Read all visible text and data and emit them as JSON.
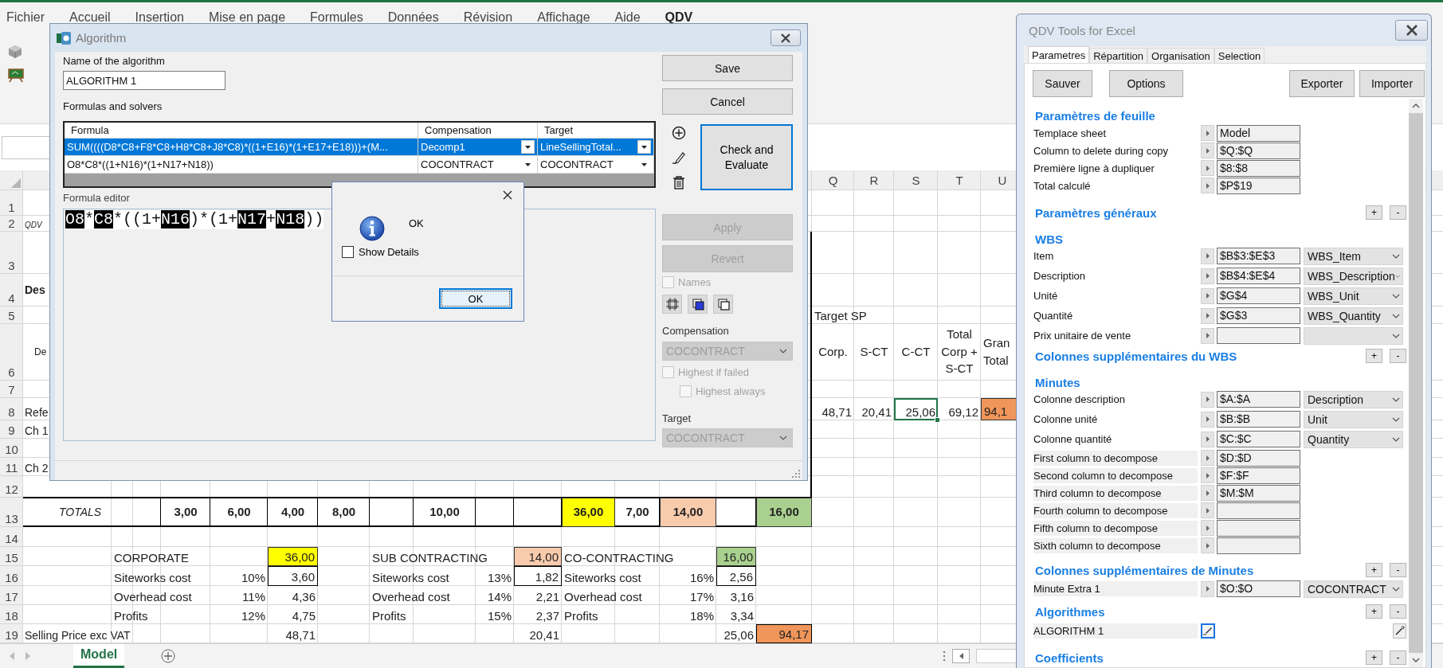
{
  "ribbon": {
    "tabs": [
      {
        "label": "Fichier",
        "selected": false
      },
      {
        "label": "Accueil",
        "selected": false
      },
      {
        "label": "Insertion",
        "selected": false
      },
      {
        "label": "Mise en page",
        "selected": false
      },
      {
        "label": "Formules",
        "selected": false
      },
      {
        "label": "Données",
        "selected": false
      },
      {
        "label": "Révision",
        "selected": false
      },
      {
        "label": "Affichage",
        "selected": false
      },
      {
        "label": "Aide",
        "selected": false
      },
      {
        "label": "QDV",
        "selected": true
      }
    ]
  },
  "sheet": {
    "columns": [
      {
        "label": "Q"
      },
      {
        "label": "R"
      },
      {
        "label": "S"
      },
      {
        "label": "T"
      },
      {
        "label": "U"
      }
    ],
    "rows": [
      {
        "number": "1"
      },
      {
        "number": "2",
        "cells": [
          {
            "text": "QDV",
            "kind": "note",
            "selected": false
          }
        ]
      },
      {
        "number": "3"
      },
      {
        "number": "4",
        "cells": [
          {
            "text": "Des",
            "kind": "bold",
            "selected": false
          }
        ]
      },
      {
        "number": "5",
        "cells": [
          null,
          null,
          null,
          null,
          null,
          null,
          null,
          null,
          null,
          null,
          null,
          null,
          null,
          null,
          null,
          null,
          {
            "text": "Target SP",
            "kind": "text",
            "selected": false
          }
        ]
      },
      {
        "number": "6",
        "cells": [
          {
            "text": "De",
            "kind": "small",
            "selected": false
          },
          null,
          null,
          null,
          null,
          null,
          null,
          null,
          null,
          null,
          null,
          null,
          null,
          null,
          null,
          null,
          {
            "text": "Corp.",
            "kind": "heading",
            "selected": false
          },
          {
            "text": "S-CT",
            "kind": "heading",
            "selected": false
          },
          {
            "text": "C-CT",
            "kind": "heading",
            "selected": false
          },
          {
            "text": "Total Corp + S-CT",
            "kind": "heading",
            "selected": false
          },
          {
            "text": "Gran Total",
            "kind": "heading_left",
            "selected": false
          }
        ]
      },
      {
        "number": "7"
      },
      {
        "number": "8",
        "cells": [
          {
            "text": "Refe",
            "kind": "text",
            "selected": false
          },
          null,
          null,
          null,
          null,
          null,
          null,
          null,
          null,
          null,
          null,
          null,
          null,
          null,
          null,
          null,
          {
            "text": "48,71",
            "kind": "number",
            "selected": false
          },
          {
            "text": "20,41",
            "kind": "number",
            "selected": false
          },
          {
            "text": "25,06",
            "kind": "number",
            "selected": true
          },
          {
            "text": "69,12",
            "kind": "number",
            "selected": false
          },
          {
            "text": "94,1",
            "kind": "text",
            "color": "#f0965a",
            "selected": false
          }
        ]
      },
      {
        "number": "9",
        "cells": [
          {
            "text": "Ch 1",
            "kind": "text",
            "selected": false
          }
        ]
      },
      {
        "number": "10"
      },
      {
        "number": "11",
        "cells": [
          {
            "text": "Ch 2",
            "kind": "text",
            "selected": false
          }
        ]
      },
      {
        "number": "12"
      },
      {
        "number": "13",
        "kind": "totals",
        "cells": [
          {
            "text": "TOTALS",
            "kind": "total_label",
            "selected": false
          },
          null,
          null,
          {
            "text": "3,00",
            "kind": "number",
            "selected": false
          },
          {
            "text": "6,00",
            "kind": "number",
            "selected": false
          },
          {
            "text": "4,00",
            "kind": "number",
            "selected": false
          },
          {
            "text": "8,00",
            "kind": "number",
            "selected": false
          },
          null,
          {
            "text": "10,00",
            "kind": "number",
            "selected": false
          },
          null,
          null,
          {
            "text": "36,00",
            "kind": "number",
            "color": "#ffff00",
            "selected": false
          },
          {
            "text": "7,00",
            "kind": "number",
            "selected": false
          },
          {
            "text": "14,00",
            "kind": "number",
            "color": "#f8cbad",
            "selected": false
          },
          null,
          {
            "text": "16,00",
            "kind": "number",
            "color": "#a9d08e",
            "selected": false
          }
        ]
      },
      {
        "number": "14"
      },
      {
        "number": "15",
        "cells": [
          null,
          {
            "text": "CORPORATE",
            "kind": "text",
            "selected": false
          },
          null,
          null,
          null,
          {
            "text": "36,00",
            "kind": "number",
            "color": "#ffff00",
            "selected": false
          },
          null,
          {
            "text": "SUB CONTRACTING",
            "kind": "text",
            "selected": false
          },
          null,
          null,
          {
            "text": "14,00",
            "kind": "number",
            "color": "#f8cbad",
            "selected": false
          },
          {
            "text": "CO-CONTRACTING",
            "kind": "text",
            "selected": false
          },
          null,
          null,
          {
            "text": "16,00",
            "kind": "number",
            "color": "#a9d08e",
            "selected": false
          }
        ]
      },
      {
        "number": "16",
        "cells": [
          null,
          {
            "text": "Siteworks cost",
            "kind": "text",
            "selected": false
          },
          null,
          null,
          {
            "text": "10%",
            "kind": "number",
            "selected": false
          },
          {
            "text": "3,60",
            "kind": "number",
            "boxed": true,
            "selected": false
          },
          null,
          {
            "text": "Siteworks cost",
            "kind": "text",
            "selected": false
          },
          null,
          {
            "text": "13%",
            "kind": "number",
            "selected": false
          },
          {
            "text": "1,82",
            "kind": "number",
            "boxed": true,
            "selected": false
          },
          {
            "text": "Siteworks cost",
            "kind": "text",
            "selected": false
          },
          null,
          {
            "text": "16%",
            "kind": "number",
            "selected": false
          },
          {
            "text": "2,56",
            "kind": "number",
            "boxed": true,
            "selected": false
          }
        ]
      },
      {
        "number": "17",
        "cells": [
          null,
          {
            "text": "Overhead cost",
            "kind": "text",
            "selected": false
          },
          null,
          null,
          {
            "text": "11%",
            "kind": "number",
            "selected": false
          },
          {
            "text": "4,36",
            "kind": "number",
            "selected": false
          },
          null,
          {
            "text": "Overhead cost",
            "kind": "text",
            "selected": false
          },
          null,
          {
            "text": "14%",
            "kind": "number",
            "selected": false
          },
          {
            "text": "2,21",
            "kind": "number",
            "selected": false
          },
          {
            "text": "Overhead cost",
            "kind": "text",
            "selected": false
          },
          null,
          {
            "text": "17%",
            "kind": "number",
            "selected": false
          },
          {
            "text": "3,16",
            "kind": "number",
            "selected": false
          }
        ]
      },
      {
        "number": "18",
        "cells": [
          null,
          {
            "text": "Profits",
            "kind": "text",
            "selected": false
          },
          null,
          null,
          {
            "text": "12%",
            "kind": "number",
            "selected": false
          },
          {
            "text": "4,75",
            "kind": "number",
            "selected": false
          },
          null,
          {
            "text": "Profits",
            "kind": "text",
            "selected": false
          },
          null,
          {
            "text": "15%",
            "kind": "number",
            "selected": false
          },
          {
            "text": "2,37",
            "kind": "number",
            "selected": false
          },
          {
            "text": "Profits",
            "kind": "text",
            "selected": false
          },
          null,
          {
            "text": "18%",
            "kind": "number",
            "selected": false
          },
          {
            "text": "3,34",
            "kind": "number",
            "selected": false
          }
        ]
      },
      {
        "number": "19",
        "cells": [
          {
            "text": "Selling Price  exc VAT",
            "kind": "text",
            "selected": false
          },
          null,
          null,
          null,
          null,
          {
            "text": "48,71",
            "kind": "number",
            "selected": false
          },
          null,
          null,
          null,
          null,
          {
            "text": "20,41",
            "kind": "number",
            "selected": false
          },
          null,
          null,
          null,
          {
            "text": "25,06",
            "kind": "number",
            "selected": false
          },
          {
            "text": "94,17",
            "kind": "number",
            "color": "#f0965a",
            "boxed": true,
            "selected": false
          }
        ]
      }
    ],
    "sheet_tabs": [
      {
        "label": "Model",
        "selected": true
      }
    ]
  },
  "algorithm_dialog": {
    "title": "Algorithm",
    "name_label": "Name of the algorithm",
    "name_value": "ALGORITHM 1",
    "formulas_label": "Formulas and solvers",
    "columns": [
      "Formula",
      "Compensation",
      "Target"
    ],
    "formulas": [
      {
        "formula": "SUM((((D8*C8+F8*C8+H8*C8+J8*C8)*((1+E16)*(1+E17+E18)))+(M...",
        "compensation": "Decomp1",
        "target": "LineSellingTotal...",
        "selected": true
      },
      {
        "formula": "O8*C8*((1+N16)*(1+N17+N18))",
        "compensation": "COCONTRACT",
        "target": "COCONTRACT",
        "selected": false
      }
    ],
    "save": "Save",
    "cancel": "Cancel",
    "check": "Check and Evaluate",
    "editor_label": "Formula editor",
    "editor_tokens": [
      {
        "text": "O8",
        "kind": "ref"
      },
      {
        "text": "*",
        "kind": "op"
      },
      {
        "text": "C8",
        "kind": "ref"
      },
      {
        "text": "*((1+",
        "kind": "op"
      },
      {
        "text": "N16",
        "kind": "ref"
      },
      {
        "text": ")*(1+",
        "kind": "op"
      },
      {
        "text": "N17",
        "kind": "ref"
      },
      {
        "text": "+",
        "kind": "op"
      },
      {
        "text": "N18",
        "kind": "ref"
      },
      {
        "text": "))",
        "kind": "op"
      }
    ],
    "apply": {
      "label": "Apply",
      "disabled": true
    },
    "revert": {
      "label": "Revert",
      "disabled": true
    },
    "names": {
      "label": "Names",
      "checked": false,
      "disabled": true
    },
    "compensation_label": "Compensation",
    "compensation_value": "COCONTRACT",
    "highest_if_failed": {
      "label": "Highest if failed",
      "checked": false,
      "disabled": true
    },
    "highest_always": {
      "label": "Highest always",
      "checked": false,
      "disabled": true
    },
    "target_label": "Target",
    "target_value": "COCONTRACT"
  },
  "message_box": {
    "message": "OK",
    "show_details": {
      "label": "Show Details",
      "checked": false
    },
    "ok": "OK"
  },
  "qdv_panel": {
    "title": "QDV Tools for Excel",
    "tabs": [
      {
        "label": "Parametres",
        "selected": true
      },
      {
        "label": "Répartition",
        "selected": false
      },
      {
        "label": "Organisation",
        "selected": false
      },
      {
        "label": "Selection",
        "selected": false
      }
    ],
    "buttons": [
      "Sauver",
      "Options",
      "Exporter",
      "Importer"
    ],
    "sections": [
      {
        "title": "Paramètres de feuille",
        "rows": [
          {
            "kind": "field",
            "label": "Templace sheet",
            "value": "Model"
          },
          {
            "kind": "field",
            "label": "Column to delete during copy",
            "value": "$Q:$Q"
          },
          {
            "kind": "field",
            "label": "Première ligne à dupliquer",
            "value": "$8:$8"
          },
          {
            "kind": "field",
            "label": "Total calculé",
            "value": "$P$19"
          }
        ]
      },
      {
        "title": "Paramètres généraux",
        "buttons": [
          "+",
          "-"
        ]
      },
      {
        "title": "WBS",
        "rows": [
          {
            "kind": "combo",
            "label": "Item",
            "value": "$B$3:$E$3",
            "option": "WBS_Item"
          },
          {
            "kind": "combo",
            "label": "Description",
            "value": "$B$4:$E$4",
            "option": "WBS_Description"
          },
          {
            "kind": "combo",
            "label": "Unité",
            "value": "$G$4",
            "option": "WBS_Unit"
          },
          {
            "kind": "combo",
            "label": "Quantité",
            "value": "$G$3",
            "option": "WBS_Quantity"
          },
          {
            "kind": "combo",
            "label": "Prix unitaire de vente"
          }
        ]
      },
      {
        "title": "Colonnes supplémentaires du WBS",
        "buttons": [
          "+",
          "-"
        ]
      },
      {
        "title": "Minutes",
        "rows": [
          {
            "kind": "combo",
            "label": "Colonne description",
            "value": "$A:$A",
            "option": "Description"
          },
          {
            "kind": "combo",
            "label": "Colonne unité",
            "value": "$B:$B",
            "option": "Unit"
          },
          {
            "kind": "combo",
            "label": "Colonne quantité",
            "value": "$C:$C",
            "option": "Quantity"
          },
          {
            "kind": "shaded",
            "label": "First column to decompose",
            "value": "$D:$D"
          },
          {
            "kind": "shaded",
            "label": "Second column to decompose",
            "value": "$F:$F"
          },
          {
            "kind": "shaded",
            "label": "Third column to decompose",
            "value": "$M:$M"
          },
          {
            "kind": "shaded",
            "label": "Fourth column to decompose"
          },
          {
            "kind": "shaded",
            "label": "Fifth column to decompose"
          },
          {
            "kind": "shaded",
            "label": "Sixth column to decompose"
          }
        ]
      },
      {
        "title": "Colonnes supplémentaires de Minutes",
        "buttons": [
          "+",
          "-"
        ],
        "rows": [
          {
            "kind": "shaded_combo",
            "label": "Minute Extra 1",
            "value": "$O:$O",
            "option": "COCONTRACT"
          }
        ]
      },
      {
        "title": "Algorithmes",
        "buttons": [
          "+",
          "-"
        ],
        "rows": [
          {
            "kind": "algorithm",
            "label": "ALGORITHM 1"
          }
        ]
      },
      {
        "title": "Coefficients",
        "buttons": [
          "+",
          "-"
        ]
      }
    ]
  }
}
